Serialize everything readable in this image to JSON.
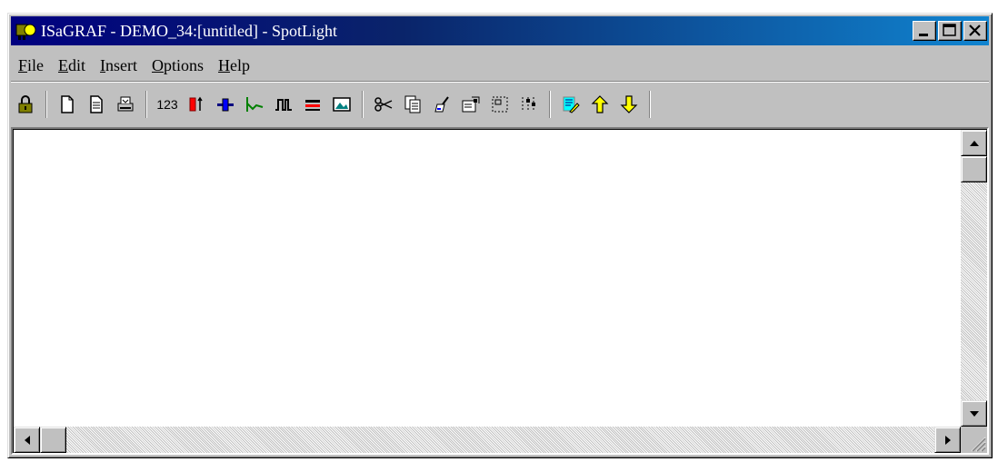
{
  "window": {
    "title": "ISaGRAF - DEMO_34:[untitled] - SpotLight",
    "buttons": [
      "minimize",
      "maximize",
      "close"
    ]
  },
  "menu": {
    "items": [
      {
        "label": "File",
        "accel": "F",
        "rest": "ile"
      },
      {
        "label": "Edit",
        "accel": "E",
        "rest": "dit"
      },
      {
        "label": "Insert",
        "accel": "I",
        "rest": "nsert"
      },
      {
        "label": "Options",
        "accel": "O",
        "rest": "ptions"
      },
      {
        "label": "Help",
        "accel": "H",
        "rest": "elp"
      }
    ]
  },
  "toolbar": {
    "text_123": "123",
    "icons": [
      "lock-icon",
      "new-document-icon",
      "open-document-icon",
      "print-icon",
      "numeric-value-icon",
      "bar-graph-icon",
      "slider-icon",
      "trend-icon",
      "pulse-icon",
      "list-icon",
      "picture-icon",
      "cut-icon",
      "copy-icon",
      "paint-icon",
      "properties-icon",
      "select-area-icon",
      "grid-icon",
      "edit-graphic-icon",
      "arrow-up-icon",
      "arrow-down-icon"
    ]
  },
  "colors": {
    "title_start": "#000080",
    "title_end": "#1084d0",
    "face": "#c0c0c0",
    "arrow_yellow": "#ffff00"
  }
}
